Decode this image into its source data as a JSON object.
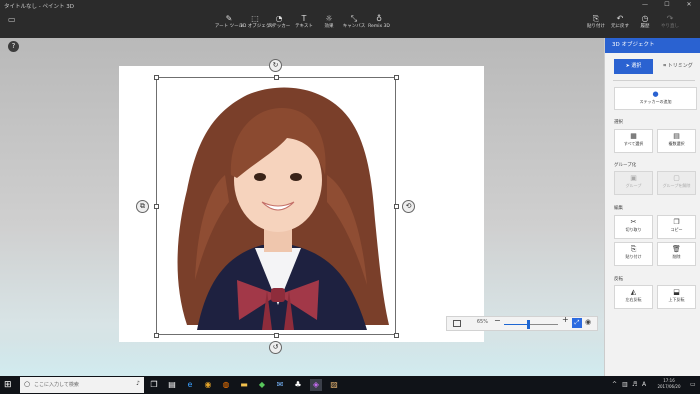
{
  "window": {
    "title": "タイトルなし - ペイント 3D",
    "minimize": "—",
    "maximize": "☐",
    "close": "✕"
  },
  "toolbar": {
    "menu_icon": "folder-icon",
    "tools": [
      {
        "label": "アート ツール",
        "icon": "brush-icon"
      },
      {
        "label": "3D オブジェクト",
        "icon": "cube-icon"
      },
      {
        "label": "ステッカー",
        "icon": "sticker-icon"
      },
      {
        "label": "テキスト",
        "icon": "text-icon"
      },
      {
        "label": "効果",
        "icon": "sun-icon"
      },
      {
        "label": "キャンバス",
        "icon": "canvas-icon"
      },
      {
        "label": "Remix 3D",
        "icon": "remix-icon"
      }
    ],
    "right": [
      {
        "label": "貼り付け",
        "icon": "paste-icon"
      },
      {
        "label": "元に戻す",
        "icon": "undo-icon"
      },
      {
        "label": "履歴",
        "icon": "history-icon"
      },
      {
        "label": "やり直し",
        "icon": "redo-icon"
      }
    ]
  },
  "canvas": {
    "help": "?"
  },
  "zoom": {
    "value": "65%",
    "minus": "−",
    "plus": "+",
    "level": 0.65
  },
  "panel": {
    "title": "3D オブジェクト",
    "mode_select": "選択",
    "mode_crop": "トリミング",
    "sticker_button": "ステッカーの追加",
    "section_select": "選択",
    "select_all": "すべて選択",
    "select_multi": "複数選択",
    "section_group": "グループ化",
    "group": "グループ",
    "ungroup": "グループを解除",
    "section_edit": "編集",
    "cut": "切り取り",
    "copy": "コピー",
    "paste": "貼り付け",
    "delete": "削除",
    "section_flip": "反転",
    "flip_h": "左右反転",
    "flip_v": "上下反転"
  },
  "taskbar": {
    "search_placeholder": "ここに入力して検索",
    "time": "17:16",
    "date": "2017/06/20"
  }
}
